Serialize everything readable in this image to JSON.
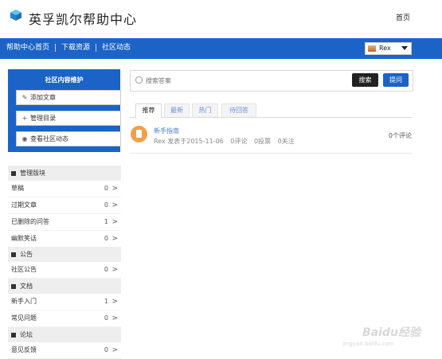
{
  "header": {
    "title": "英孚凯尔帮助中心",
    "home": "首页",
    "logo_icon": "cube-logo-icon"
  },
  "nav": {
    "links": [
      "帮助中心首页",
      "下载资源",
      "社区动态"
    ],
    "user": "Rex",
    "bg_color": "#1b63c6"
  },
  "community": {
    "title": "社区内容维护",
    "buttons": [
      {
        "icon": "pencil-icon",
        "glyph": "✎",
        "label": "添加文章"
      },
      {
        "icon": "plus-icon",
        "glyph": "+",
        "label": "管理目录"
      },
      {
        "icon": "eye-icon",
        "glyph": "◉",
        "label": "查看社区动态"
      }
    ]
  },
  "sections": [
    {
      "title": "管理版块",
      "rows": [
        {
          "label": "草稿",
          "count": "0"
        },
        {
          "label": "过期文章",
          "count": "0"
        },
        {
          "label": "已删除的问答",
          "count": "1"
        },
        {
          "label": "幽默笑话",
          "count": "0"
        }
      ]
    },
    {
      "title": "公告",
      "rows": [
        {
          "label": "社区公告",
          "count": "0"
        }
      ]
    },
    {
      "title": "文档",
      "rows": [
        {
          "label": "新手入门",
          "count": "1"
        },
        {
          "label": "常见问题",
          "count": "0"
        }
      ]
    },
    {
      "title": "论坛",
      "rows": [
        {
          "label": "意见反馈",
          "count": "0"
        }
      ]
    }
  ],
  "search": {
    "placeholder": "搜索答案",
    "search_label": "搜索",
    "ask_label": "提问"
  },
  "tabs": [
    "推荐",
    "最新",
    "热门",
    "待回答"
  ],
  "post": {
    "title": "新手指南",
    "author": "Rex 发表于2015-11-06",
    "comments": "0评论",
    "votes": "0投票",
    "follows": "0关注",
    "right_comments": "0个评论"
  },
  "watermark": {
    "brand": "Baidu经验",
    "url": "jingyan.baidu.com"
  }
}
